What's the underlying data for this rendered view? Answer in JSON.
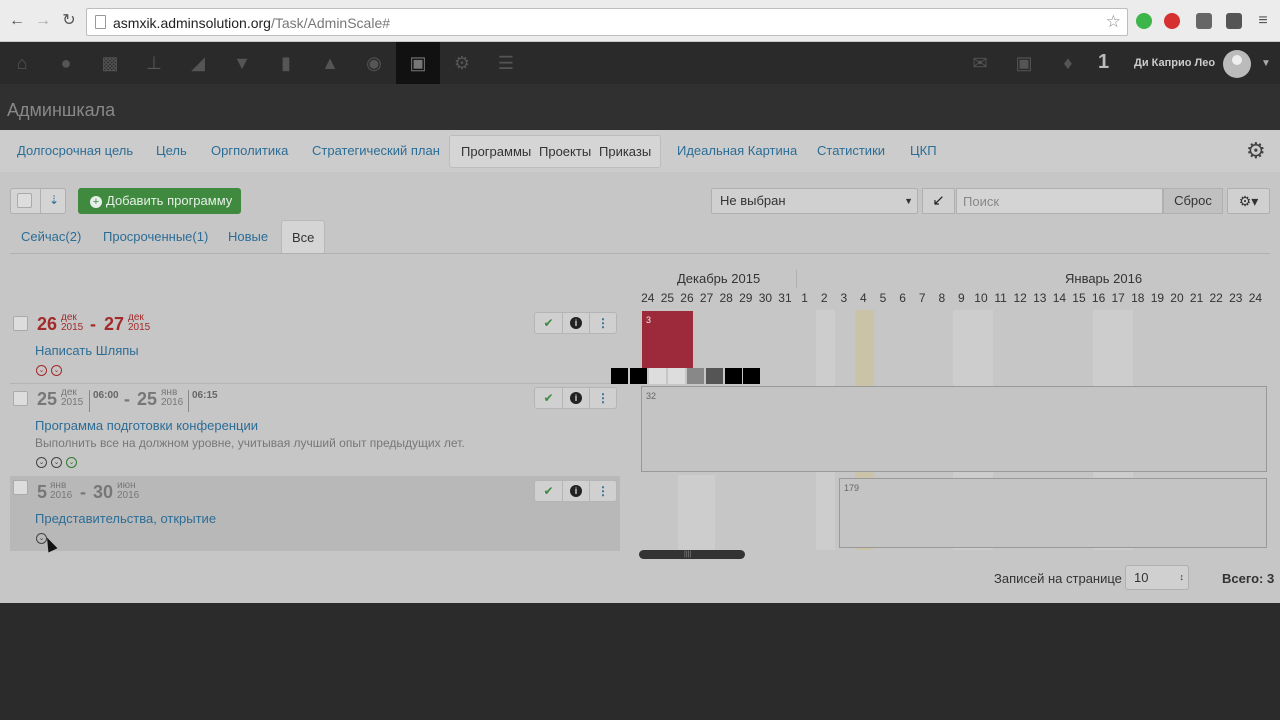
{
  "browser": {
    "url_host": "asmxik.adminsolution.org",
    "url_path": "/Task/AdminScale#"
  },
  "topnav": {
    "icons": [
      "home-icon",
      "users-icon",
      "factory-icon",
      "org-chart-icon",
      "chart-area-icon",
      "filter-icon",
      "bar-chart-icon",
      "hat-icon",
      "money-bag-icon",
      "briefcase-icon",
      "gear-icon",
      "list-icon"
    ],
    "right_icons": [
      "mail-icon",
      "briefcase-icon",
      "bell-icon"
    ],
    "notification_count": "1",
    "user_name": "Ди Каприо Лео"
  },
  "page_title": "Админшкала",
  "main_tabs": [
    {
      "label": "Долгосрочная цель"
    },
    {
      "label": "Цель"
    },
    {
      "label": "Оргполитика"
    },
    {
      "label": "Стратегический план"
    },
    {
      "label": "Идеальная Картина"
    },
    {
      "label": "Статистики"
    },
    {
      "label": "ЦКП"
    }
  ],
  "main_tab_group": [
    "Программы",
    "Проекты",
    "Приказы"
  ],
  "toolbar": {
    "add_label": "Добавить программу",
    "select_value": "Не выбран",
    "search_placeholder": "Поиск",
    "reset_label": "Сброс"
  },
  "filter_tabs": [
    {
      "label": "Сейчас(2)"
    },
    {
      "label": "Просроченные(1)"
    },
    {
      "label": "Новые"
    },
    {
      "label": "Все"
    }
  ],
  "tasks": [
    {
      "start_day": "26",
      "start_month": "дек",
      "start_year": "2015",
      "end_day": "27",
      "end_month": "дек",
      "end_year": "2015",
      "title": "Написать Шляпы",
      "status_color": "#a32a2a"
    },
    {
      "start_day": "25",
      "start_month": "дек",
      "start_year": "2015",
      "start_time": "06:00",
      "end_day": "25",
      "end_month": "янв",
      "end_year": "2016",
      "end_time": "06:15",
      "title": "Программа подготовки конференции",
      "description": "Выполнить все на должном уровне, учитывая лучший опыт предыдущих лет."
    },
    {
      "start_day": "5",
      "start_month": "янв",
      "start_year": "2016",
      "end_day": "30",
      "end_month": "июн",
      "end_year": "2016",
      "title": "Представительства, открытие"
    }
  ],
  "date_separator": "-",
  "gantt": {
    "months": [
      "Декабрь 2015",
      "Январь 2016"
    ],
    "days": [
      "24",
      "25",
      "26",
      "27",
      "28",
      "29",
      "30",
      "31",
      "1",
      "2",
      "3",
      "4",
      "5",
      "6",
      "7",
      "8",
      "9",
      "10",
      "11",
      "12",
      "13",
      "14",
      "15",
      "16",
      "17",
      "18",
      "19",
      "20",
      "21",
      "22",
      "23",
      "24"
    ],
    "bars": [
      {
        "label": "3",
        "color": "#9c2a3a"
      },
      {
        "label": "32",
        "color": "#c4c4c4"
      },
      {
        "label": "179",
        "color": "#c4c4c4"
      }
    ]
  },
  "pager": {
    "records_label": "Записей на странице",
    "records_value": "10",
    "total_label": "Всего: 3"
  }
}
